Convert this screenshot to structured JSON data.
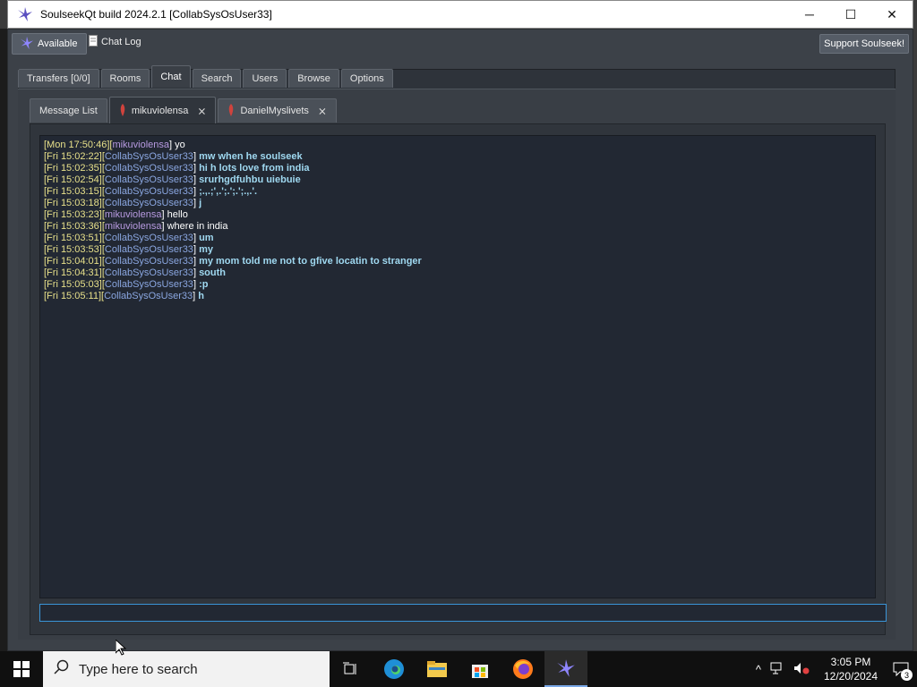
{
  "window": {
    "title": "SoulseekQt build 2024.2.1 [CollabSysOsUser33]",
    "controls": [
      "─",
      "☐",
      "✕"
    ]
  },
  "toolbar": {
    "status_label": "Available",
    "chatlog_label": "Chat Log",
    "support_label": "Support Soulseek!"
  },
  "main_tabs": [
    "Transfers [0/0]",
    "Rooms",
    "Chat",
    "Search",
    "Users",
    "Browse",
    "Options"
  ],
  "chat_tabs": {
    "message_list": "Message List",
    "conversations": [
      "mikuviolensa",
      "DanielMyslivets"
    ]
  },
  "messages": [
    {
      "ts": "[Mon 17:50:46]",
      "user": "mikuviolensa",
      "text": "yo",
      "self": false
    },
    {
      "ts": "[Fri 15:02:22]",
      "user": "CollabSysOsUser33",
      "text": "mw when he soulseek",
      "self": true
    },
    {
      "ts": "[Fri 15:02:35]",
      "user": "CollabSysOsUser33",
      "text": "hi h lots love from india",
      "self": true
    },
    {
      "ts": "[Fri 15:02:54]",
      "user": "CollabSysOsUser33",
      "text": "srurhgdfuhbu uiebuie",
      "self": true
    },
    {
      "ts": "[Fri 15:03:15]",
      "user": "CollabSysOsUser33",
      "text": ";.,.;',.';.';.';.,.'.",
      "self": true
    },
    {
      "ts": "[Fri 15:03:18]",
      "user": "CollabSysOsUser33",
      "text": "j",
      "self": true
    },
    {
      "ts": "[Fri 15:03:23]",
      "user": "mikuviolensa",
      "text": "hello",
      "self": false
    },
    {
      "ts": "[Fri 15:03:36]",
      "user": "mikuviolensa",
      "text": "where in india",
      "self": false
    },
    {
      "ts": "[Fri 15:03:51]",
      "user": "CollabSysOsUser33",
      "text": "um",
      "self": true
    },
    {
      "ts": "[Fri 15:03:53]",
      "user": "CollabSysOsUser33",
      "text": "my",
      "self": true
    },
    {
      "ts": "[Fri 15:04:01]",
      "user": "CollabSysOsUser33",
      "text": "my mom told me not to gfive locatin to stranger",
      "self": true
    },
    {
      "ts": "[Fri 15:04:31]",
      "user": "CollabSysOsUser33",
      "text": "south",
      "self": true
    },
    {
      "ts": "[Fri 15:05:03]",
      "user": "CollabSysOsUser33",
      "text": ":p",
      "self": true
    },
    {
      "ts": "[Fri 15:05:11]",
      "user": "CollabSysOsUser33",
      "text": "h",
      "self": true
    }
  ],
  "chat_input": {
    "value": ""
  },
  "taskbar": {
    "search_placeholder": "Type here to search",
    "time": "3:05 PM",
    "date": "12/20/2024",
    "notification_count": "3"
  },
  "colors": {
    "timestamp": "#e7e08a",
    "other_user": "#b79ae0",
    "self_user": "#8aa6e0",
    "self_message": "#9fd8f0"
  }
}
